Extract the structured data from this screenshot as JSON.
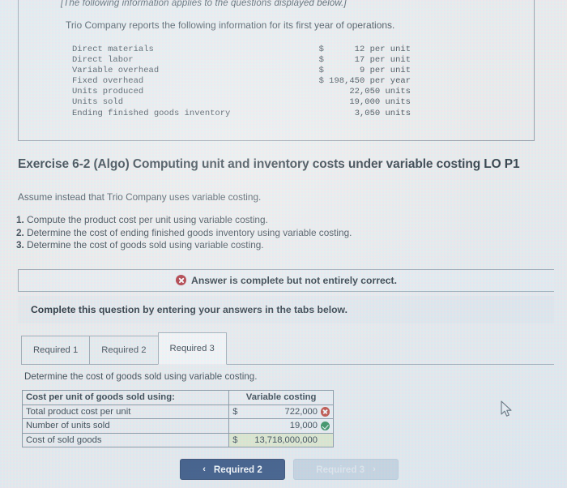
{
  "info_box": {
    "italic_note": "[The following information applies to the questions displayed below.]",
    "lead": "Trio Company reports the following information for its first year of operations.",
    "rows": [
      {
        "label": "Direct materials",
        "value": "$      12 per unit"
      },
      {
        "label": "Direct labor",
        "value": "$      17 per unit"
      },
      {
        "label": "Variable overhead",
        "value": "$       9 per unit"
      },
      {
        "label": "Fixed overhead",
        "value": "$ 198,450 per year"
      },
      {
        "label": "Units produced",
        "value": "22,050 units"
      },
      {
        "label": "Units sold",
        "value": "19,000 units"
      },
      {
        "label": "Ending finished goods inventory",
        "value": "3,050 units"
      }
    ]
  },
  "exercise": {
    "title": "Exercise 6-2 (Algo) Computing unit and inventory costs under variable costing LO P1",
    "assume": "Assume instead that Trio Company uses variable costing.",
    "requirements": [
      {
        "num": "1.",
        "text": "Compute the product cost per unit using variable costing."
      },
      {
        "num": "2.",
        "text": "Determine the cost of ending finished goods inventory using variable costing."
      },
      {
        "num": "3.",
        "text": "Determine the cost of goods sold using variable costing."
      }
    ]
  },
  "answer_banner": {
    "status_text": "Answer is complete but not entirely correct.",
    "status_icon": "error-x-icon",
    "instruction": "Complete this question by entering your answers in the tabs below."
  },
  "tabs": [
    {
      "label": "Required 1",
      "active": false
    },
    {
      "label": "Required 2",
      "active": false
    },
    {
      "label": "Required 3",
      "active": true
    }
  ],
  "answer_panel": {
    "prompt": "Determine the cost of goods sold using variable costing.",
    "table": {
      "header": {
        "label": "Cost per unit of goods sold using:",
        "value": "Variable costing"
      },
      "rows": [
        {
          "label": "Total product cost per unit",
          "currency": "$",
          "value": "722,000",
          "mark": "error-x-icon"
        },
        {
          "label": "Number of units sold",
          "currency": "",
          "value": "19,000",
          "mark": "check-icon"
        },
        {
          "label": "Cost of sold goods",
          "currency": "$",
          "value": "13,718,000,000",
          "mark": ""
        }
      ]
    }
  },
  "nav": {
    "prev": {
      "label": "Required 2",
      "chevron": "‹",
      "disabled": false
    },
    "next": {
      "label": "Required 3",
      "chevron": "›",
      "disabled": true
    }
  },
  "colors": {
    "accent_navy": "#1f3f73",
    "error_red": "#c0392b",
    "success_green": "#1e8449",
    "highlight_yellow": "#d6e9a0"
  }
}
